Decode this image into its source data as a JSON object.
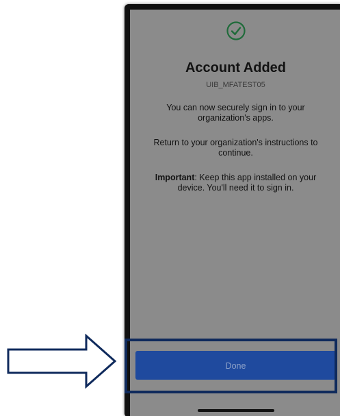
{
  "screen": {
    "icon": "check-circle-icon",
    "title": "Account Added",
    "account_id": "UIB_MFATEST05",
    "message_1": "You can now securely sign in to your organization's apps.",
    "message_2": "Return to your organization's instructions to continue.",
    "important_label": "Important",
    "important_text": ": Keep this app installed on your device. You'll need it to sign in.",
    "done_label": "Done"
  },
  "annotation": {
    "arrow_icon": "right-arrow-icon",
    "highlight_color": "#0f2a5c"
  },
  "colors": {
    "accent": "#1f4a9e",
    "success": "#1f6b3a",
    "overlay": "#8b8b8b"
  }
}
